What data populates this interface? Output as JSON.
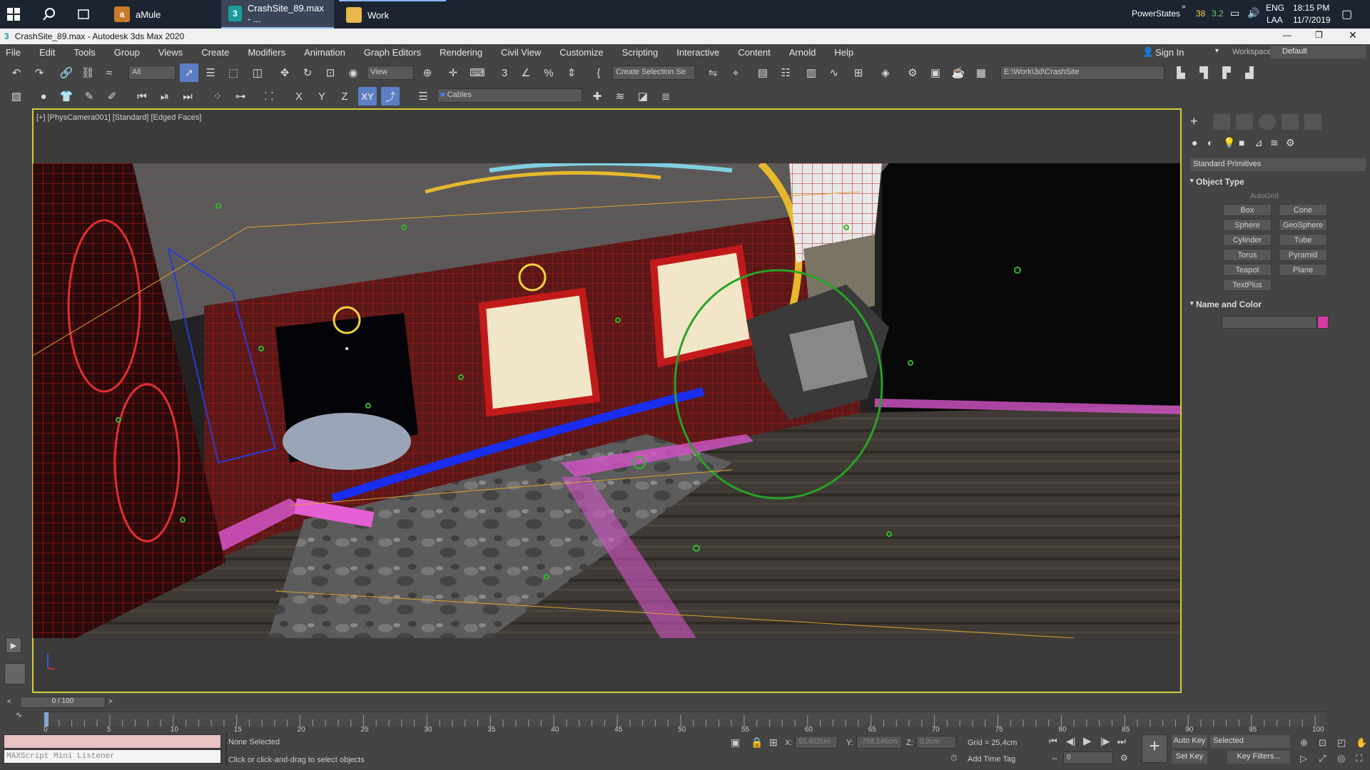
{
  "taskbar": {
    "apps": [
      {
        "label": "aMule"
      },
      {
        "label": "CrashSite_89.max - ..."
      },
      {
        "label": "Work"
      }
    ],
    "tray_label": "PowerStates",
    "tray_num1": "38",
    "tray_num2": "3.2",
    "lang": "ENG",
    "lang2": "LAA",
    "time": "18:15 PM",
    "date": "11/7/2019"
  },
  "window": {
    "title": "CrashSite_89.max - Autodesk 3ds Max 2020"
  },
  "menu": [
    "File",
    "Edit",
    "Tools",
    "Group",
    "Views",
    "Create",
    "Modifiers",
    "Animation",
    "Graph Editors",
    "Rendering",
    "Civil View",
    "Customize",
    "Scripting",
    "Interactive",
    "Content",
    "Arnold",
    "Help"
  ],
  "signin": "Sign In",
  "workspaces_label": "Workspaces:",
  "workspaces_value": "Default",
  "toolbar": {
    "filter": "All",
    "view": "View",
    "selection_set": "Create Selection Se",
    "path": "E:\\Work\\3d\\CrashSite",
    "axis_x": "X",
    "axis_y": "Y",
    "axis_z": "Z",
    "axis_xy": "XY",
    "layer": "Cables"
  },
  "viewport": {
    "label": "[+] [PhysCamera001] [Standard] [Edged Faces]"
  },
  "command_panel": {
    "dropdown": "Standard Primitives",
    "object_type": "Object Type",
    "autogrid": "AutoGrid",
    "buttons": [
      "Box",
      "Cone",
      "Sphere",
      "GeoSphere",
      "Cylinder",
      "Tube",
      "Torus",
      "Pyramid",
      "Teapot",
      "Plane",
      "TextPlus"
    ],
    "name_color": "Name and Color",
    "swatch": "#d63aa0"
  },
  "timeline": {
    "frame": "0 / 100",
    "ticks": [
      "0",
      "5",
      "10",
      "15",
      "20",
      "25",
      "30",
      "35",
      "40",
      "45",
      "50",
      "55",
      "60",
      "65",
      "70",
      "75",
      "80",
      "85",
      "90",
      "95",
      "100"
    ]
  },
  "status": {
    "maxscript": "MAXScript Mini Listener",
    "selected": "None Selected",
    "hint": "Click or click-and-drag to select objects",
    "x_label": "X:",
    "x_val": "55,402cm",
    "y_label": "Y:",
    "y_val": "-758,146cm",
    "z_label": "Z:",
    "z_val": "0,0cm",
    "grid": "Grid = 25,4cm",
    "add_time_tag": "Add Time Tag",
    "auto_key": "Auto Key",
    "selected_dd": "Selected",
    "set_key": "Set Key",
    "key_filters": "Key Filters...",
    "frame_field": "0"
  }
}
